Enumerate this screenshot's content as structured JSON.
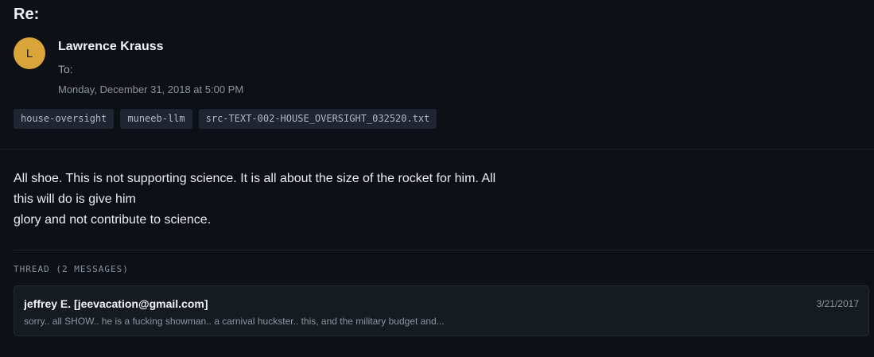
{
  "email": {
    "subject": "Re:",
    "avatar_initial": "L",
    "sender": "Lawrence Krauss",
    "to_label": "To:",
    "date": "Monday, December 31, 2018 at 5:00 PM",
    "tags": [
      "house-oversight",
      "muneeb-llm",
      "src-TEXT-002-HOUSE_OVERSIGHT_032520.txt"
    ],
    "body_lines": [
      "All shoe. This is not supporting science. It is all about the size of the rocket for him. All",
      "this will do is give him",
      "glory and not contribute to science."
    ]
  },
  "thread": {
    "label": "THREAD (2 MESSAGES)",
    "items": [
      {
        "from": "jeffrey E. [jeevacation@gmail.com]",
        "date": "3/21/2017",
        "snippet": "sorry.. all SHOW.. he is a fucking showman.. a carnival huckster.. this, and the military budget and..."
      }
    ]
  },
  "colors": {
    "background": "#0d1117",
    "avatar": "#d9a53b",
    "tag_background": "#1f2631"
  }
}
